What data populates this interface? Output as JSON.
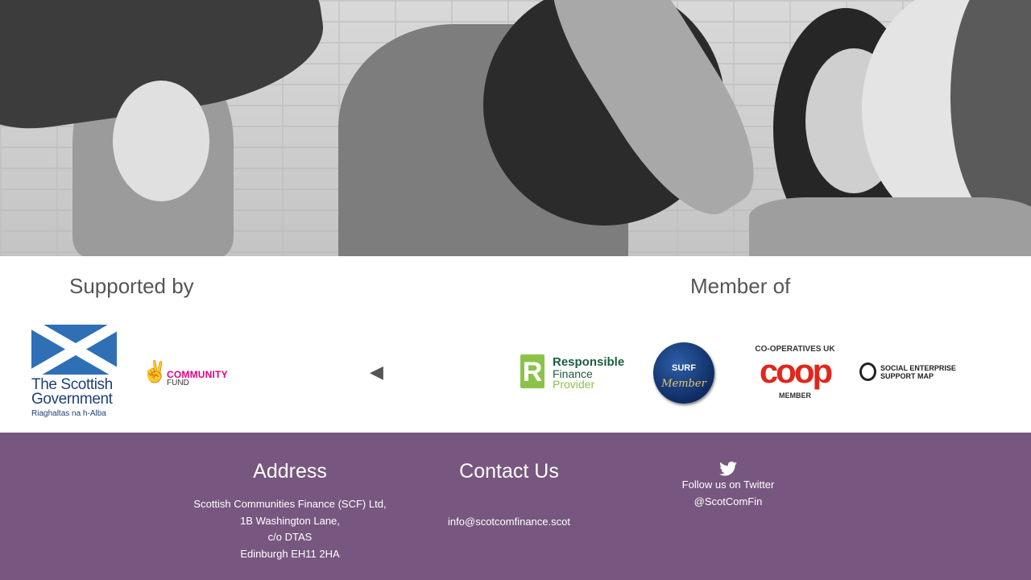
{
  "supported": {
    "heading": "Supported by",
    "scottish_gov": {
      "line1": "The Scottish",
      "line2": "Government",
      "line3": "Riaghaltas na h-Alba"
    },
    "community_fund": {
      "line1": "COMMUNITY",
      "line2": "FUND"
    }
  },
  "member": {
    "heading": "Member of",
    "rfp": {
      "letter": "R",
      "line1": "Responsible",
      "line2": "Finance",
      "line3": "Provider"
    },
    "surf": {
      "line1": "SURF",
      "line2": "Member"
    },
    "coop": {
      "line1": "CO-OPERATIVES UK",
      "line2": "coop",
      "line3": "MEMBER"
    },
    "sesm": {
      "line1": "SOCIAL ENTERPRISE",
      "line2": "SUPPORT MAP"
    }
  },
  "carousel": {
    "prev_glyph": "◀"
  },
  "footer": {
    "address": {
      "heading": "Address",
      "lines": [
        "Scottish Communities Finance (SCF) Ltd,",
        "1B Washington Lane,",
        "c/o DTAS",
        "Edinburgh EH11 2HA"
      ]
    },
    "contact": {
      "heading": "Contact Us",
      "email": "info@scotcomfinance.scot"
    },
    "twitter": {
      "label": "Follow us on Twitter",
      "handle": "@ScotComFin"
    }
  },
  "colors": {
    "footer_bg": "#77577f",
    "heading_text": "#555555"
  }
}
